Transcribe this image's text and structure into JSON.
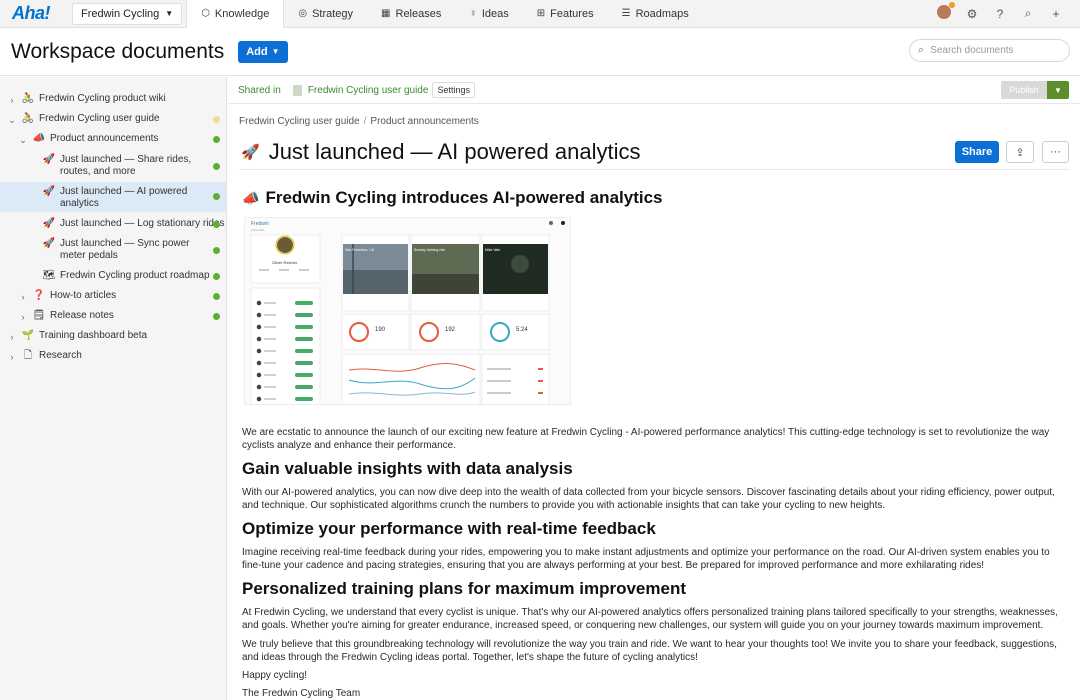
{
  "nav": {
    "logo": "Aha!",
    "workspace": "Fredwin Cycling",
    "tabs": [
      {
        "label": "Knowledge",
        "icon": "knowledge-icon"
      },
      {
        "label": "Strategy",
        "icon": "strategy-icon"
      },
      {
        "label": "Releases",
        "icon": "releases-icon"
      },
      {
        "label": "Ideas",
        "icon": "ideas-icon"
      },
      {
        "label": "Features",
        "icon": "features-icon"
      },
      {
        "label": "Roadmaps",
        "icon": "roadmaps-icon"
      }
    ]
  },
  "header": {
    "title": "Workspace documents",
    "add_label": "Add",
    "search_placeholder": "Search documents"
  },
  "sidebar": {
    "items": [
      {
        "label": "Fredwin Cycling product wiki",
        "icon": "cyclist-icon"
      },
      {
        "label": "Fredwin Cycling user guide",
        "icon": "cyclist-icon",
        "status": "#f2dc8a"
      },
      {
        "label": "Product announcements",
        "icon": "megaphone-icon",
        "status": "#5bb030"
      },
      {
        "label": "Just launched — Share rides, routes, and more",
        "icon": "rocket-icon",
        "status": "#5bb030"
      },
      {
        "label": "Just launched — AI powered analytics",
        "icon": "rocket-icon",
        "status": "#5bb030"
      },
      {
        "label": "Just launched — Log stationary rides",
        "icon": "rocket-icon",
        "status": "#5bb030"
      },
      {
        "label": "Just launched — Sync power meter pedals",
        "icon": "rocket-icon",
        "status": "#5bb030"
      },
      {
        "label": "Fredwin Cycling product roadmap",
        "icon": "map-icon",
        "status": "#5bb030"
      },
      {
        "label": "How-to articles",
        "icon": "question-icon",
        "status": "#5bb030"
      },
      {
        "label": "Release notes",
        "icon": "notepad-icon",
        "status": "#5bb030"
      },
      {
        "label": "Training dashboard beta",
        "icon": "sprout-icon"
      },
      {
        "label": "Research",
        "icon": "document-icon"
      }
    ]
  },
  "subheader": {
    "shared_in": "Shared in",
    "doc_link": "Fredwin Cycling user guide",
    "settings": "Settings",
    "publish": "Publish"
  },
  "doc": {
    "breadcrumb": [
      "Fredwin Cycling user guide",
      "Product announcements"
    ],
    "title": "Just launched — AI powered analytics",
    "share": "Share",
    "subtitle": "Fredwin Cycling introduces AI-powered analytics",
    "intro": "We are ecstatic to announce the launch of our exciting new feature at Fredwin Cycling - AI-powered performance analytics! This cutting-edge technology is set to revolutionize the way cyclists analyze and enhance their performance.",
    "h_insights": "Gain valuable insights with data analysis",
    "p_insights": "With our AI-powered analytics, you can now dive deep into the wealth of data collected from your bicycle sensors. Discover fascinating details about your riding efficiency, power output, and technique. Our sophisticated algorithms crunch the numbers to provide you with actionable insights that can take your cycling to new heights.",
    "h_feedback": "Optimize your performance with real-time feedback",
    "p_feedback": "Imagine receiving real-time feedback during your rides, empowering you to make instant adjustments and optimize your performance on the road. Our AI-driven system enables you to fine-tune your cadence and pacing strategies, ensuring that you are always performing at your best. Be prepared for improved performance and more exhilarating rides!",
    "h_training": "Personalized training plans for maximum improvement",
    "p_training": "At Fredwin Cycling, we understand that every cyclist is unique. That's why our AI-powered analytics offers personalized training plans tailored specifically to your strengths, weaknesses, and goals. Whether you're aiming for greater endurance, increased speed, or conquering new challenges, our system will guide you on your journey towards maximum improvement.",
    "p_believe": "We truly believe that this groundbreaking technology will revolutionize the way you train and ride. We want to hear your thoughts too! We invite you to share your feedback, suggestions, and ideas through the Fredwin Cycling ideas portal. Together, let's shape the future of cycling analytics!",
    "signoff": "Happy cycling!",
    "team": "The Fredwin Cycling Team"
  },
  "screenshot": {
    "brand": "Fredwin",
    "brand_sub": "CYCLING",
    "user": "Oliver Reicher",
    "cards": [
      {
        "place": "San Francisco, CA",
        "value": "190"
      },
      {
        "place": "Sunday training ride",
        "value": "192"
      },
      {
        "place": "Mike Vale",
        "value": "5:24"
      }
    ]
  },
  "colors": {
    "accent": "#0b6fd6",
    "green": "#5bb030",
    "link_green": "#3b8a2e"
  }
}
